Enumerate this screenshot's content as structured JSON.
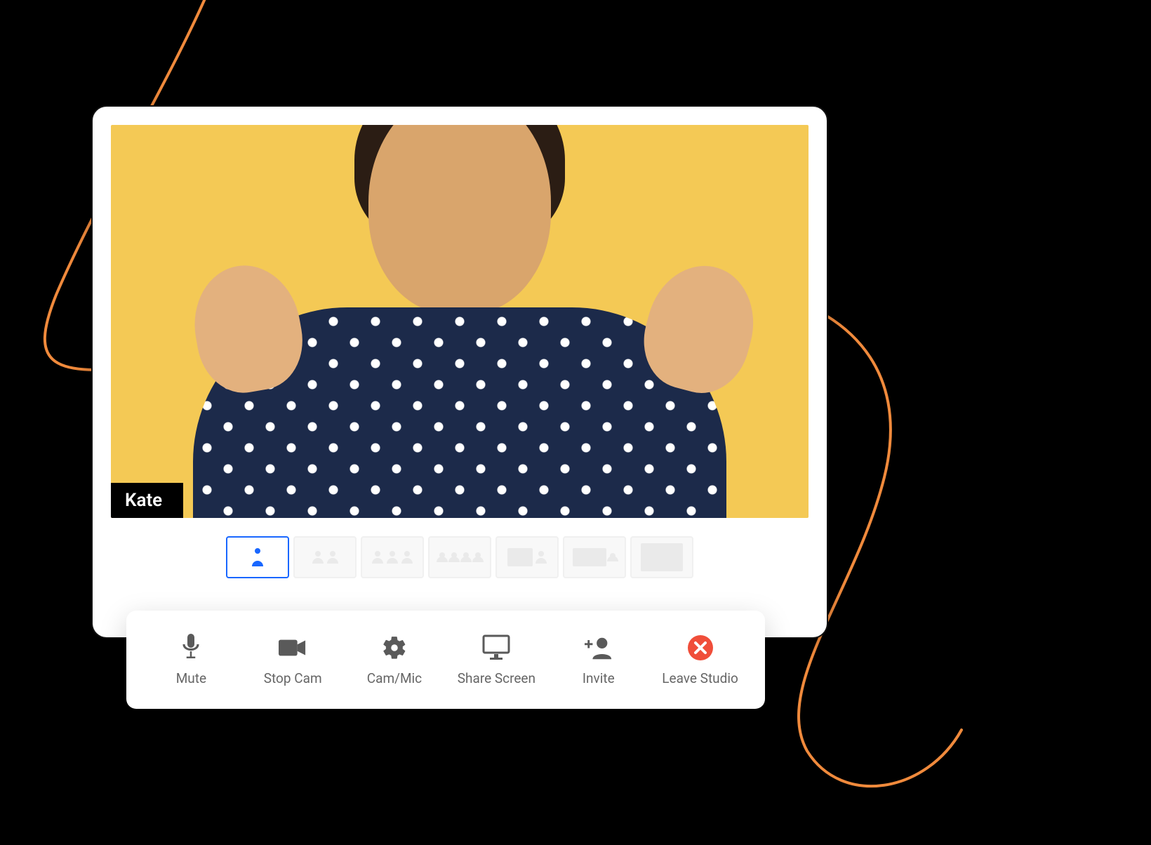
{
  "participant": {
    "name": "Kate"
  },
  "layouts": {
    "count": 7,
    "active_index": 0
  },
  "toolbar": {
    "mute_label": "Mute",
    "stopcam_label": "Stop Cam",
    "cammic_label": "Cam/Mic",
    "sharescreen_label": "Share Screen",
    "invite_label": "Invite",
    "leave_label": "Leave Studio"
  },
  "colors": {
    "accent": "#1967ff",
    "danger": "#F04E3A",
    "video_bg": "#F4C955",
    "scribble": "#F08A3C"
  }
}
